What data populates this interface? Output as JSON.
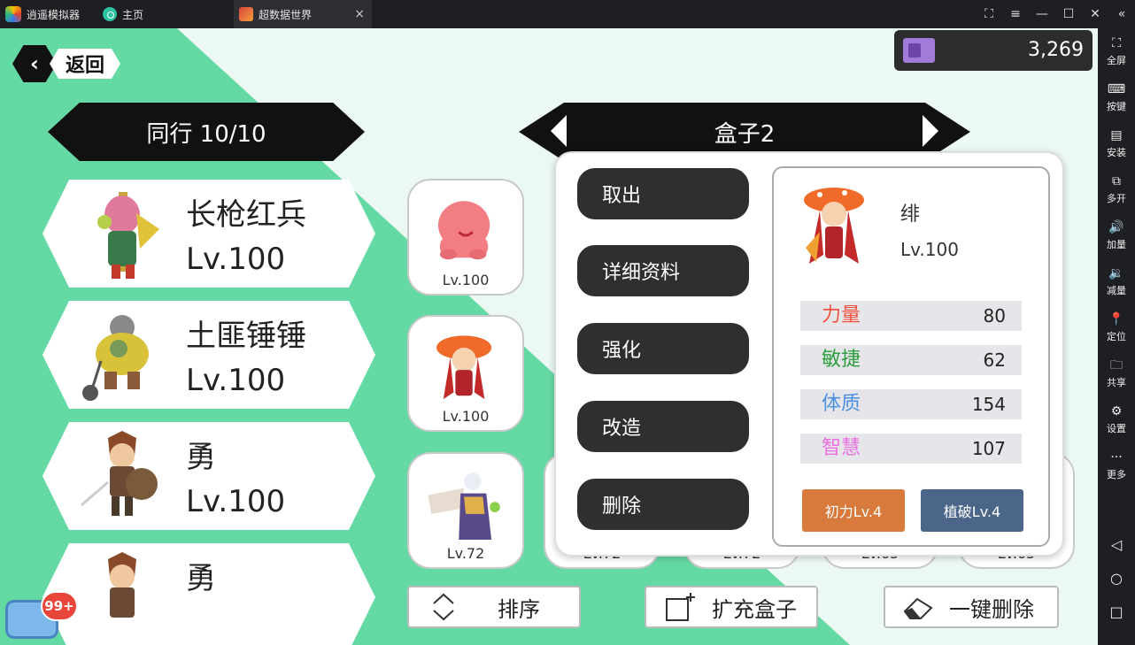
{
  "titlebar": {
    "app_name": "逍遥模拟器",
    "home_tab": "主页",
    "game_tab": "超数据世界",
    "close_icon": "×",
    "controls": [
      "⛶",
      "≡",
      "—",
      "☐",
      "✕",
      "«"
    ]
  },
  "sidebar": {
    "items": [
      {
        "icon": "⛶",
        "label": "全屏"
      },
      {
        "icon": "⌨",
        "label": "按键"
      },
      {
        "icon": "▤",
        "label": "安装"
      },
      {
        "icon": "⧉",
        "label": "多开"
      },
      {
        "icon": "🔊",
        "label": "加量"
      },
      {
        "icon": "🔉",
        "label": "减量"
      },
      {
        "icon": "📍",
        "label": "定位"
      },
      {
        "icon": "🗀",
        "label": "共享"
      },
      {
        "icon": "⚙",
        "label": "设置"
      },
      {
        "icon": "···",
        "label": "更多"
      }
    ],
    "nav": [
      "◁",
      "○",
      "□"
    ]
  },
  "game": {
    "back_label": "返回",
    "back_icon": "‹",
    "currency_value": "3,269",
    "party_title": "同行 10/10",
    "box_title": "盒子2",
    "party": [
      {
        "name": "长枪红兵",
        "level": "Lv.100"
      },
      {
        "name": "土匪锤锤",
        "level": "Lv.100"
      },
      {
        "name": "勇",
        "level": "Lv.100"
      },
      {
        "name": "勇",
        "level": ""
      }
    ],
    "box_slots": [
      {
        "level": "Lv.100"
      },
      {
        "level": "Lv.100"
      },
      {
        "level": "Lv.72"
      }
    ],
    "hidden_slot_levels": [
      "Lv.72",
      "Lv.72",
      "Lv.65",
      "Lv.65"
    ],
    "menu": [
      "取出",
      "详细资料",
      "强化",
      "改造",
      "删除"
    ],
    "detail": {
      "name": "绯",
      "level": "Lv.100",
      "stats": [
        {
          "name": "力量",
          "value": "80",
          "color": "#f0533f"
        },
        {
          "name": "敏捷",
          "value": "62",
          "color": "#2e9e3e"
        },
        {
          "name": "体质",
          "value": "154",
          "color": "#4a8fe0"
        },
        {
          "name": "智慧",
          "value": "107",
          "color": "#e96fe0"
        }
      ],
      "skills": [
        {
          "label": "初力Lv.4",
          "color": "#d77a3b"
        },
        {
          "label": "植破Lv.4",
          "color": "#4b6688"
        }
      ]
    },
    "bottom": {
      "sort": "排序",
      "expand": "扩充盒子",
      "delete_all": "一键删除"
    },
    "chat_badge": "99+"
  }
}
